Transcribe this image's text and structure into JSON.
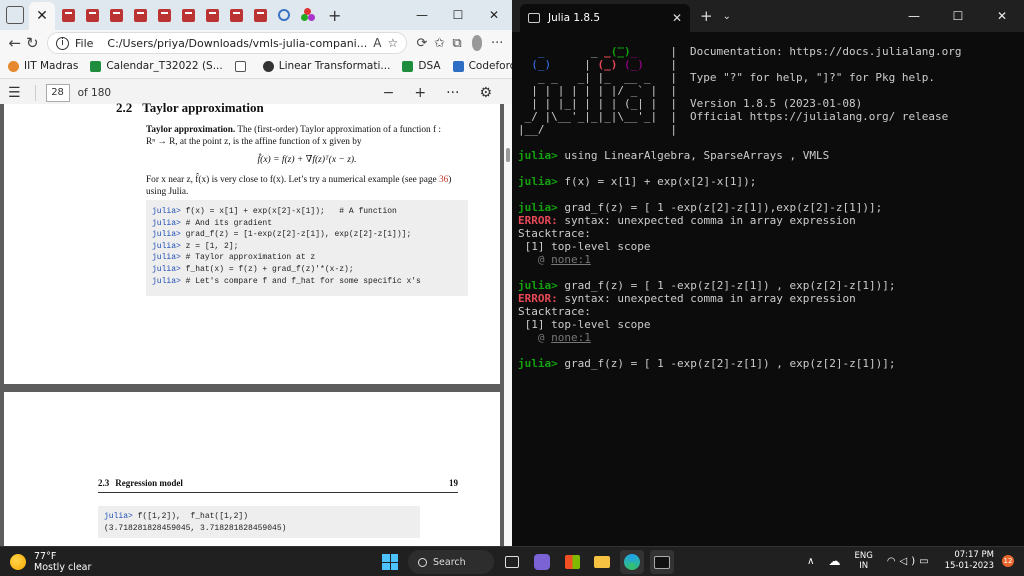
{
  "browser": {
    "url_label": "File",
    "url": "C:/Users/priya/Downloads/vmls-julia-compani...",
    "bookmarks": [
      {
        "label": "IIT Madras",
        "color": "#e6892e"
      },
      {
        "label": "Calendar_T32022 (S...",
        "color": "#1e8e3e"
      },
      {
        "label": "",
        "color": "#555555"
      },
      {
        "label": "Linear Transformati...",
        "color": "#333333"
      },
      {
        "label": "DSA",
        "color": "#1e8e3e"
      },
      {
        "label": "Codeforces",
        "color": "#2d6dc4"
      },
      {
        "label": "codechef",
        "color": "#6b4a2a"
      }
    ],
    "page_number": "28",
    "page_total": "of 180"
  },
  "pdf": {
    "section_number": "2.2",
    "section_title": "Taylor approximation",
    "para1_bold": "Taylor approximation.",
    "para1_text": " The (first-order) Taylor approximation of a function f : ",
    "para1_line2": "Rⁿ → R, at the point z, is the affine function of x given by",
    "formula": "f̂(x) = f(z) + ∇f(z)ᵀ(x − z).",
    "para2_line1a": "For x near z, f̂(x) is very close to f(x). Let’s try a numerical example (see page ",
    "para2_link": "36",
    "para2_line1b": ")",
    "para2_line2": "using Julia.",
    "code": [
      {
        "prompt": "julia>",
        "text": " f(x) = x[1] + exp(x[2]-x[1]);   # A function"
      },
      {
        "prompt": "julia>",
        "text": " # And its gradient"
      },
      {
        "prompt": "julia>",
        "text": " grad_f(z) = [1-exp(z[2]-z[1]), exp(z[2]-z[1])];"
      },
      {
        "prompt": "julia>",
        "text": " z = [1, 2];"
      },
      {
        "prompt": "julia>",
        "text": " # Taylor approximation at z"
      },
      {
        "prompt": "julia>",
        "text": " f_hat(x) = f(z) + grad_f(z)'*(x-z);"
      },
      {
        "prompt": "julia>",
        "text": " # Let's compare f and f_hat for some specific x's"
      }
    ],
    "reg_number": "2.3",
    "reg_title": "Regression model",
    "reg_page": "19",
    "code2_prompt": "julia>",
    "code2_text": " f([1,2]),  f_hat([1,2])",
    "code2_output": "(3.718281828459045, 3.718281828459045)"
  },
  "terminal": {
    "tab_title": "Julia 1.8.5",
    "banner_lines": [
      "Documentation: https://docs.julialang.org",
      "",
      "Type \"?\" for help, \"]?\" for Pkg help.",
      "",
      "Version 1.8.5 (2023-01-08)",
      "Official https://julialang.org/ release"
    ],
    "prompt": "julia>",
    "cmd1": " using LinearAlgebra, SparseArrays , VMLS",
    "cmd2": " f(x) = x[1] + exp(x[2]-x[1]);",
    "cmd3": " grad_f(z) = [ 1 -exp(z[2]-z[1]),exp(z[2]-z[1])];",
    "error_label": "ERROR:",
    "error_text": " syntax: unexpected comma in array expression",
    "stacktrace": "Stacktrace:",
    "frame": " [1] top-level scope",
    "at": "   @ ",
    "none": "none:1",
    "cmd4": " grad_f(z) = [ 1 -exp(z[2]-z[1]) , exp(z[2]-z[1])];",
    "cmd5": " grad_f(z) = [ 1 -exp(z[2]-z[1]) , exp(z[2]-z[1])];"
  },
  "taskbar": {
    "temp": "77°F",
    "weather": "Mostly clear",
    "search": "Search",
    "lang1": "ENG",
    "lang2": "IN",
    "time": "07:17 PM",
    "date": "15-01-2023",
    "notif_count": "12"
  }
}
